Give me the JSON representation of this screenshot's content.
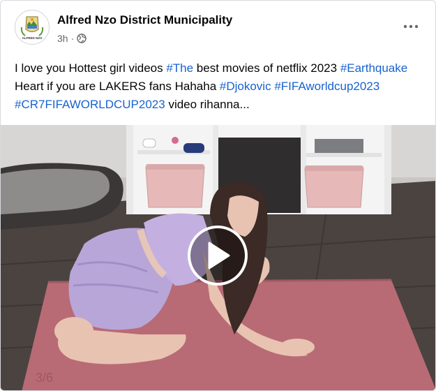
{
  "post": {
    "page_name": "Alfred Nzo District Municipality",
    "timestamp": "3h",
    "separator": "·",
    "privacy_icon": "globe-icon",
    "more_icon": "more-options-icon",
    "avatar_logo_text": "ALFRED NZO",
    "text_segments": [
      {
        "text": "I love you Hottest girl videos ",
        "hashtag": false
      },
      {
        "text": "#The",
        "hashtag": true
      },
      {
        "text": " best movies of netflix 2023 ",
        "hashtag": false
      },
      {
        "text": "#Earthquake",
        "hashtag": true
      },
      {
        "text": " Heart if you are LAKERS fans Hahaha ",
        "hashtag": false
      },
      {
        "text": "#Djokovic",
        "hashtag": true
      },
      {
        "text": " ",
        "hashtag": false
      },
      {
        "text": "#FIFAworldcup2023",
        "hashtag": true
      },
      {
        "text": " ",
        "hashtag": false
      },
      {
        "text": "#CR7FIFAWORLDCUP2023",
        "hashtag": true
      },
      {
        "text": " video rihanna...",
        "hashtag": false
      }
    ]
  },
  "video": {
    "play_icon": "play-icon",
    "mat_text": "3/6"
  },
  "colors": {
    "hashtag": "#1763cf",
    "secondary_text": "#65676b",
    "primary_text": "#050505"
  }
}
